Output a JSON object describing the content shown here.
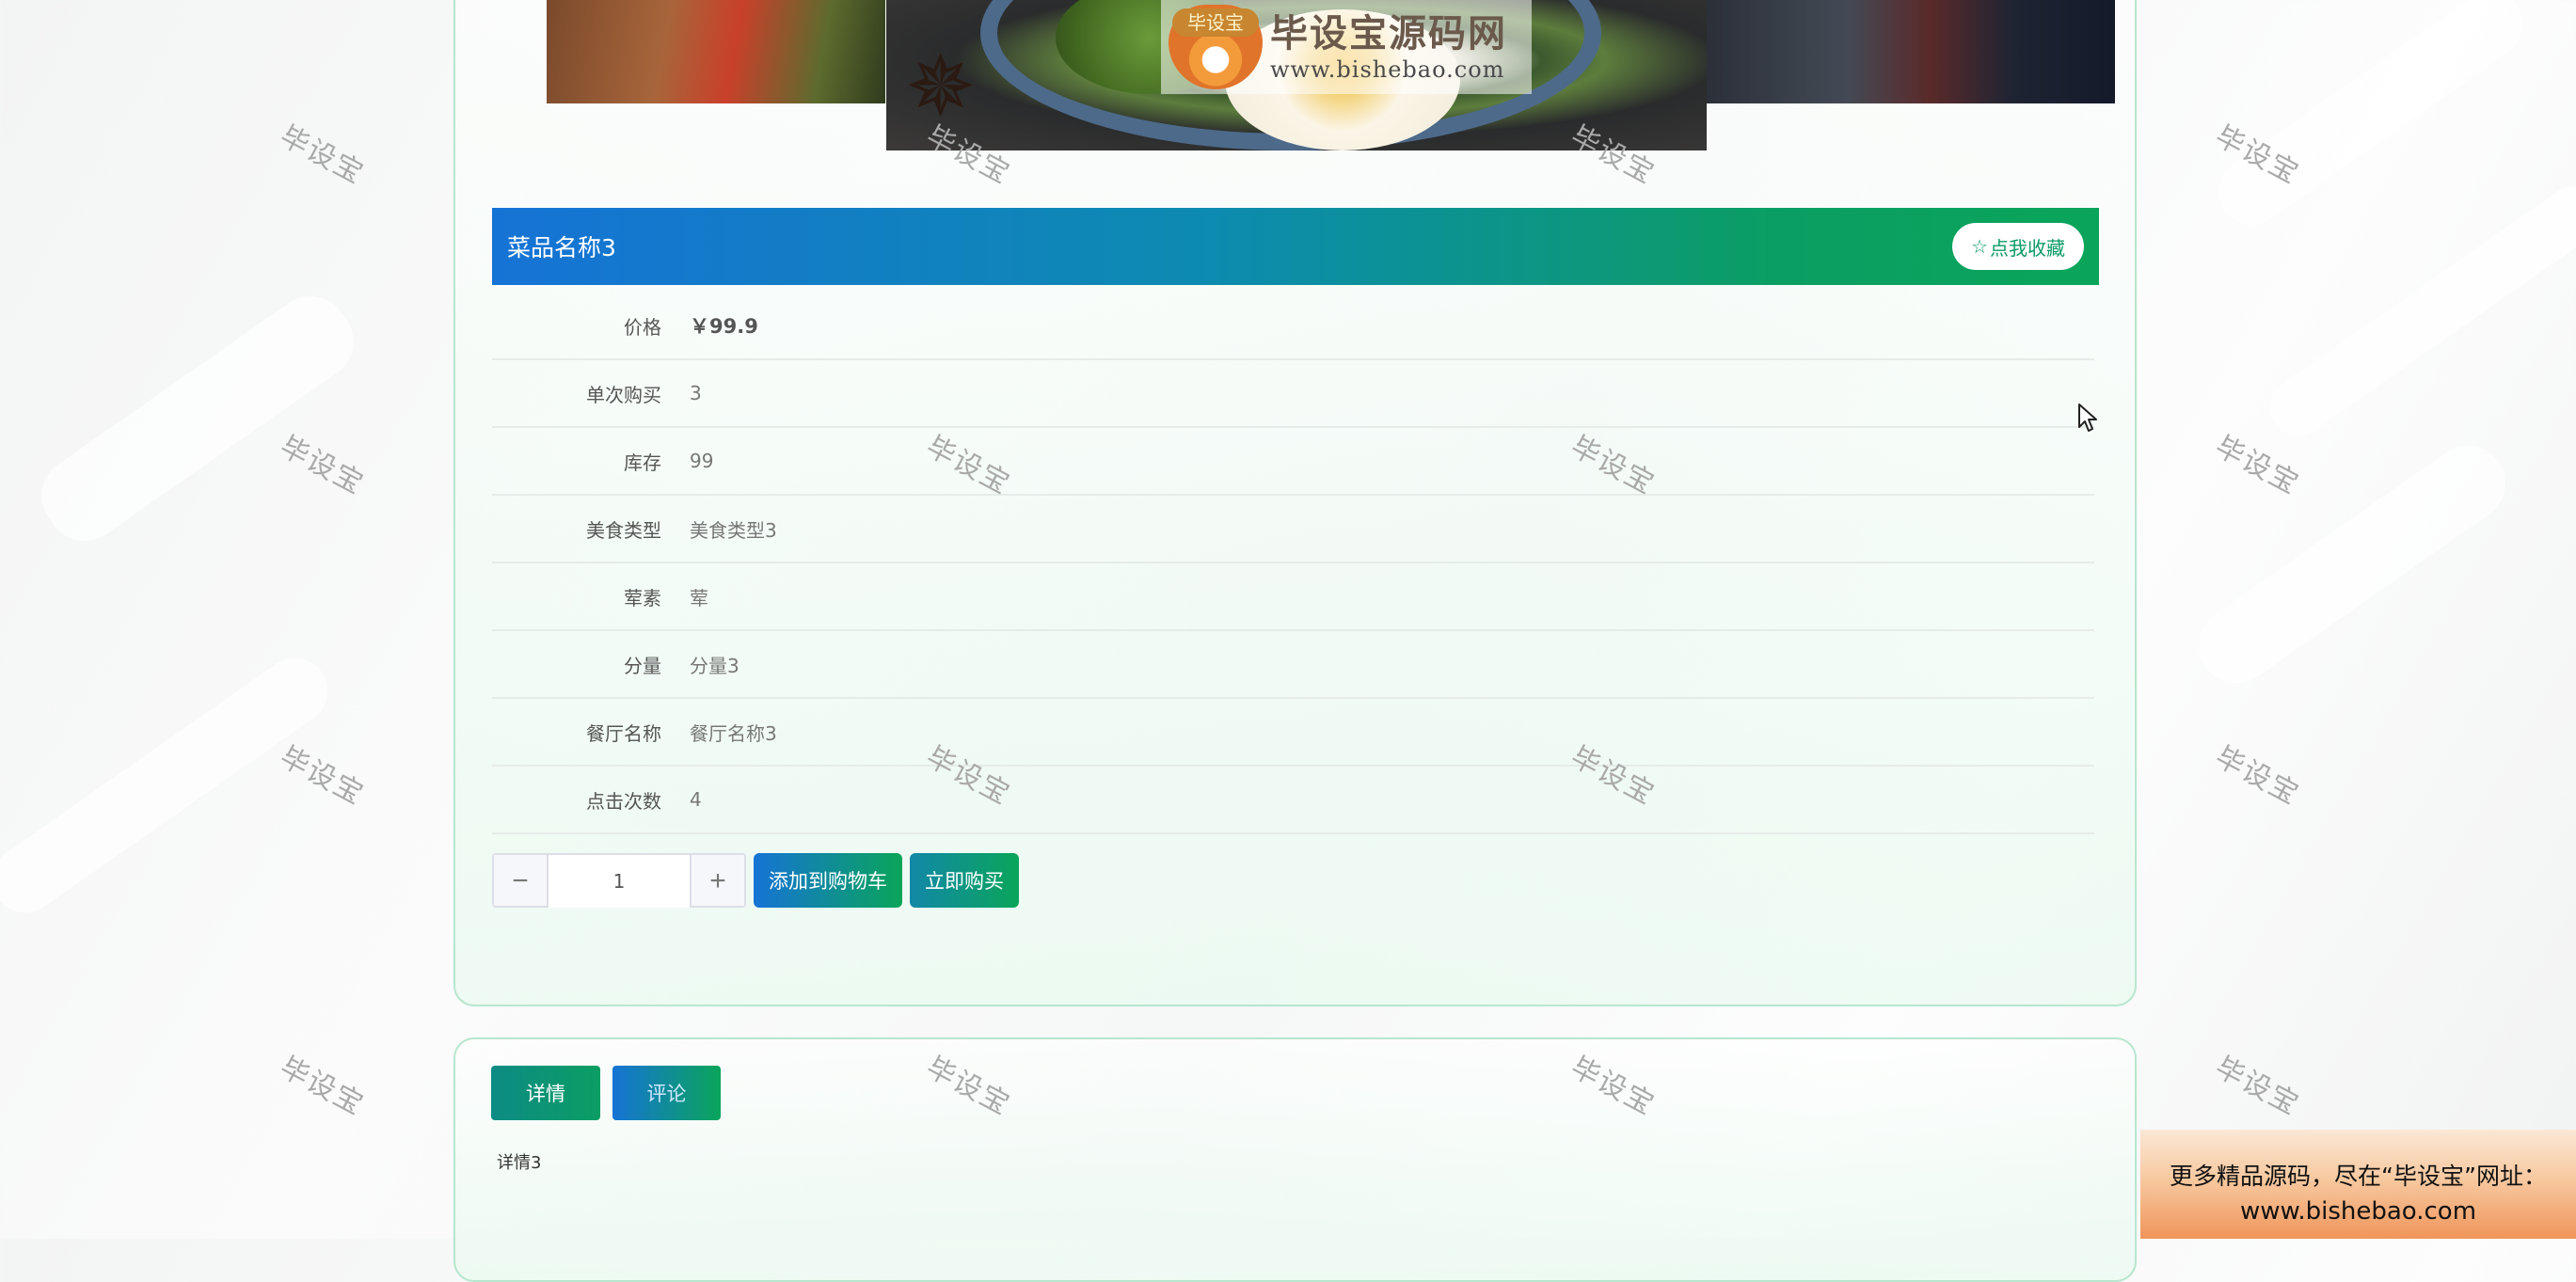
{
  "logo": {
    "title": "毕设宝源码网",
    "url": "www.bishebao.com",
    "badge": "毕设宝"
  },
  "watermark": "毕设宝",
  "product": {
    "name": "菜品名称3",
    "favorite_label": "点我收藏",
    "favorite_icon": "star-outline-icon"
  },
  "info_rows": [
    {
      "label": "价格",
      "value": "￥99.9"
    },
    {
      "label": "单次购买",
      "value": "3"
    },
    {
      "label": "库存",
      "value": "99"
    },
    {
      "label": "美食类型",
      "value": "美食类型3"
    },
    {
      "label": "荤素",
      "value": "荤"
    },
    {
      "label": "分量",
      "value": "分量3"
    },
    {
      "label": "餐厅名称",
      "value": "餐厅名称3"
    },
    {
      "label": "点击次数",
      "value": "4"
    }
  ],
  "purchase": {
    "quantity": "1",
    "add_to_cart_label": "添加到购物车",
    "buy_now_label": "立即购买"
  },
  "tabs": {
    "detail_label": "详情",
    "comment_label": "评论"
  },
  "detail_content": "详情3",
  "promo": {
    "line1": "更多精品源码，尽在“毕设宝”网址：",
    "line2": "www.bishebao.com"
  },
  "colors": {
    "accent_blue": "#1673d6",
    "accent_green": "#0aa55a"
  }
}
